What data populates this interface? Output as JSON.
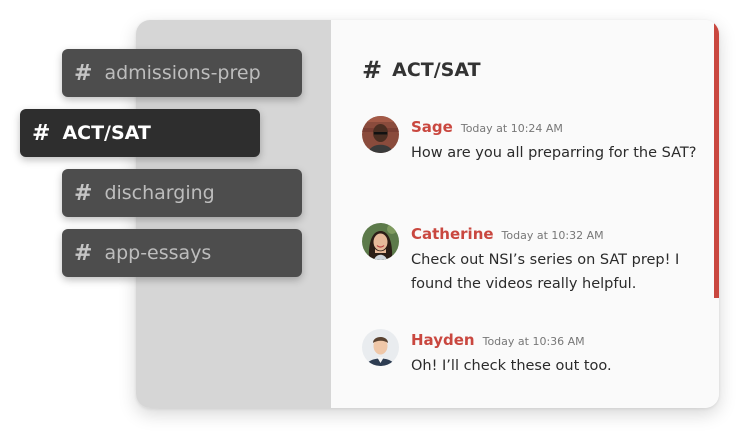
{
  "chat": {
    "channel_title": "ACT/SAT",
    "messages": [
      {
        "author": "Sage",
        "time": "Today at 10:24 AM",
        "text": "How are you all preparring for the SAT?"
      },
      {
        "author": "Catherine",
        "time": "Today at 10:32 AM",
        "text": "Check out NSI’s series on SAT prep! I found the videos really helpful."
      },
      {
        "author": "Hayden",
        "time": "Today at 10:36 AM",
        "text": "Oh! I’ll check these out too."
      }
    ]
  },
  "channels": [
    {
      "label": "admissions-prep",
      "active": false
    },
    {
      "label": "ACT/SAT",
      "active": true
    },
    {
      "label": "discharging",
      "active": false
    },
    {
      "label": "app-essays",
      "active": false
    }
  ],
  "hash_symbol": "#",
  "colors": {
    "accent": "#c9473f",
    "active_chip": "#2e2e2e",
    "muted_chip": "#4d4d4d",
    "sidebar_panel": "#d6d6d6",
    "chat_background": "#fafafa"
  },
  "icons": {
    "channel": "hash-icon",
    "avatars": [
      "avatar-sage",
      "avatar-catherine",
      "avatar-hayden"
    ]
  }
}
